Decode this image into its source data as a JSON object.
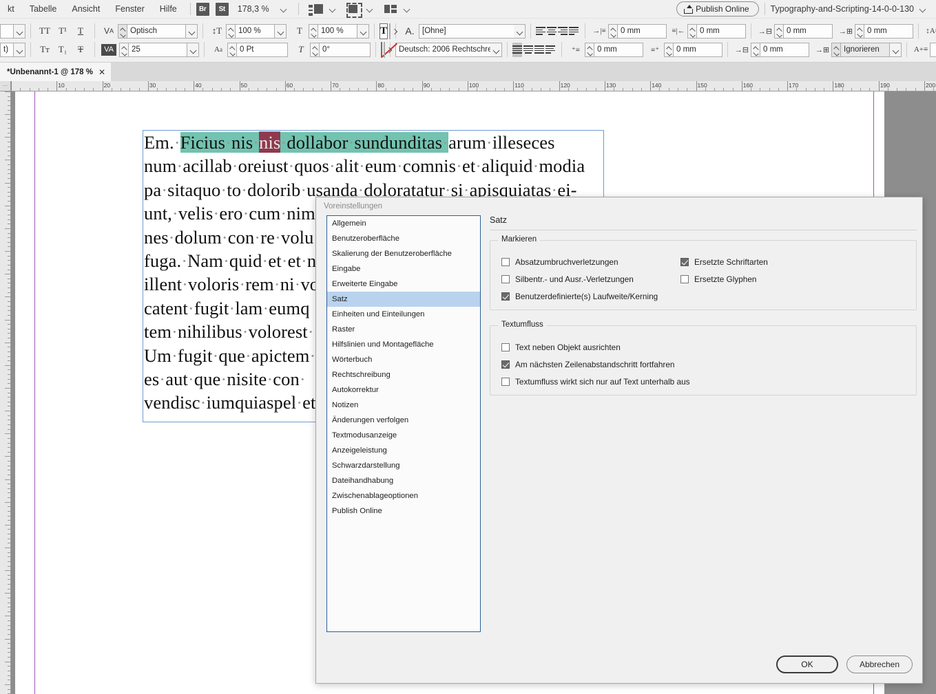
{
  "menubar": {
    "items": [
      "kt",
      "Tabelle",
      "Ansicht",
      "Fenster",
      "Hilfe"
    ],
    "bridge_badge": "Br",
    "stock_badge": "St",
    "zoom_level": "178,3 %",
    "screen_mode_icon": "screen-mode-icon",
    "view_mode_icon": "view-mode-icon",
    "arrange_icon": "arrange-documents-icon",
    "publish_online": "Publish Online",
    "workspace": "Typography-and-Scripting-14-0-0-130"
  },
  "control_panel": {
    "row1": {
      "caps_btn": "TT",
      "superscript_btn": "T¹",
      "underline_btn": "T",
      "kerning_label_icon": "optical-kerning-icon",
      "kerning_value": "Optisch",
      "vscale_icon": "vertical-scale-icon",
      "vscale_value": "100 %",
      "hscale_icon": "horizontal-scale-icon",
      "hscale_value": "100 %",
      "format_affects_text": "T",
      "para_style_icon": "paragraph-style-icon",
      "para_style_value": "[Ohne]",
      "left_indent": "0 mm",
      "right_indent": "0 mm",
      "space_before": "0 mm",
      "space_after": "0 mm",
      "align_top_icon": "align-top-icon"
    },
    "row2": {
      "smallcaps_btn": "Tт",
      "subscript_btn": "T₁",
      "strikethrough_btn": "T",
      "tracking_icon": "tracking-icon",
      "tracking_value": "25",
      "baseline_icon": "baseline-shift-icon",
      "baseline_value": "0 Pt",
      "skew_icon": "skew-icon",
      "skew_value": "0°",
      "format_affects_container": "none-swatch",
      "language_value": "Deutsch: 2006 Rechtschrei...",
      "first_line_indent": "0 mm",
      "last_line_indent": "0 mm",
      "drop_cap_lines": "0 mm",
      "hyphenation_value": "Ignorieren",
      "align_bottom_icon": "align-bottom-icon"
    }
  },
  "document_tab": {
    "title": "*Unbenannt-1 @ 178 %",
    "close": "✕"
  },
  "ruler": {
    "corner_icon": "ruler-origin-icon",
    "labels": [
      "10",
      "20",
      "30",
      "40",
      "50",
      "60",
      "70",
      "80",
      "90",
      "100",
      "110",
      "120",
      "130",
      "140",
      "150",
      "160",
      "170",
      "180",
      "190",
      "200"
    ],
    "unit": "mm"
  },
  "story": {
    "lines": [
      [
        {
          "t": "Em. ",
          "s": "plain"
        },
        {
          "t": "Ficius nis ",
          "s": "teal"
        },
        {
          "t": "nis",
          "s": "sel"
        },
        {
          "t": " dollabor sundunditas ",
          "s": "teal"
        },
        {
          "t": "arum illeseces",
          "s": "plain"
        }
      ],
      [
        {
          "t": "num acillab oreiust quos alit eum comnis et aliquid modia",
          "s": "plain"
        }
      ],
      [
        {
          "t": "pa sitaquo to dolorib usanda doloratatur si apisquiatas ei-",
          "s": "plain"
        }
      ],
      [
        {
          "t": "unt, velis ero cum nim",
          "s": "plain"
        }
      ],
      [
        {
          "t": "nes dolum con re volu",
          "s": "plain"
        }
      ],
      [
        {
          "t": "fuga. Nam quid et et n",
          "s": "plain"
        }
      ],
      [
        {
          "t": "illent voloris rem ni vo",
          "s": "plain"
        }
      ],
      [
        {
          "t": "catent fugit lam eumq",
          "s": "plain"
        }
      ],
      [
        {
          "t": "tem nihilibus volorest ",
          "s": "plain"
        }
      ],
      [
        {
          "t": "Um fugit que apictem ",
          "s": "plain"
        }
      ],
      [
        {
          "t": "es aut que nisite con ",
          "s": "plain"
        }
      ],
      [
        {
          "t": "vendisc iumquiaspel et",
          "s": "plain"
        }
      ]
    ],
    "highlight_teal": "#72c3b0",
    "selection_color": "#8d3a4e"
  },
  "dialog": {
    "title": "Voreinstellungen",
    "categories": [
      {
        "label": "Allgemein",
        "selected": false
      },
      {
        "label": "Benutzeroberfläche",
        "selected": false
      },
      {
        "label": "Skalierung der Benutzeroberfläche",
        "selected": false
      },
      {
        "label": "Eingabe",
        "selected": false
      },
      {
        "label": "Erweiterte Eingabe",
        "selected": false
      },
      {
        "label": "Satz",
        "selected": true
      },
      {
        "label": "Einheiten und Einteilungen",
        "selected": false
      },
      {
        "label": "Raster",
        "selected": false
      },
      {
        "label": "Hilfslinien und Montagefläche",
        "selected": false
      },
      {
        "label": "Wörterbuch",
        "selected": false
      },
      {
        "label": "Rechtschreibung",
        "selected": false
      },
      {
        "label": "Autokorrektur",
        "selected": false
      },
      {
        "label": "Notizen",
        "selected": false
      },
      {
        "label": "Änderungen verfolgen",
        "selected": false
      },
      {
        "label": "Textmodusanzeige",
        "selected": false
      },
      {
        "label": "Anzeigeleistung",
        "selected": false
      },
      {
        "label": "Schwarzdarstellung",
        "selected": false
      },
      {
        "label": "Dateihandhabung",
        "selected": false
      },
      {
        "label": "Zwischenablageoptionen",
        "selected": false
      },
      {
        "label": "Publish Online",
        "selected": false
      }
    ],
    "pane_title": "Satz",
    "groups": [
      {
        "label": "Markieren",
        "column1": [
          {
            "label": "Absatzumbruchverletzungen",
            "checked": false
          },
          {
            "label": "Silbentr.- und Ausr.-Verletzungen",
            "checked": false
          },
          {
            "label": "Benutzerdefinierte(s) Laufweite/Kerning",
            "checked": true
          }
        ],
        "column2": [
          {
            "label": "Ersetzte Schriftarten",
            "checked": true
          },
          {
            "label": "Ersetzte Glyphen",
            "checked": false
          }
        ]
      },
      {
        "label": "Textumfluss",
        "column1": [
          {
            "label": "Text neben Objekt ausrichten",
            "checked": false
          },
          {
            "label": "Am nächsten Zeilenabstandschritt fortfahren",
            "checked": true
          },
          {
            "label": "Textumfluss wirkt sich nur auf Text unterhalb aus",
            "checked": false
          }
        ],
        "column2": []
      }
    ],
    "ok_label": "OK",
    "cancel_label": "Abbrechen"
  }
}
